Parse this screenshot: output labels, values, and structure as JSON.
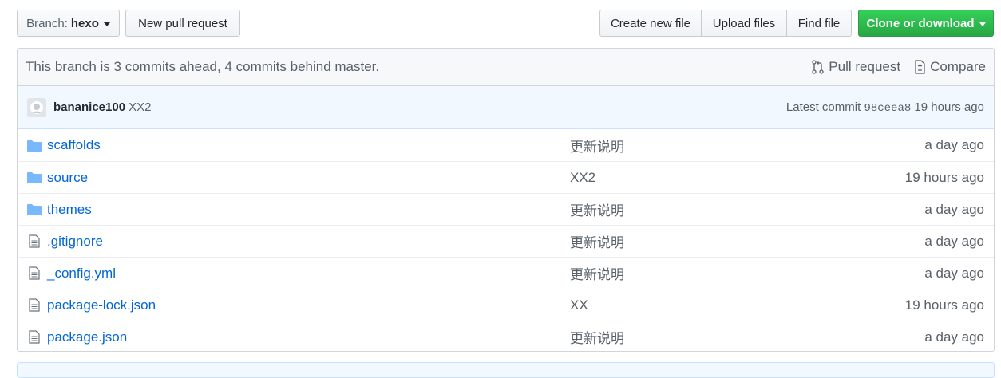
{
  "toolbar": {
    "branch_label": "Branch:",
    "branch_value": "hexo",
    "new_pull_request": "New pull request",
    "create_new_file": "Create new file",
    "upload_files": "Upload files",
    "find_file": "Find file",
    "clone_or_download": "Clone or download"
  },
  "branch_status": {
    "message": "This branch is 3 commits ahead, 4 commits behind master.",
    "pull_request": "Pull request",
    "compare": "Compare"
  },
  "latest_commit": {
    "author": "bananice100",
    "message": "XX2",
    "label": "Latest commit",
    "sha": "98ceea8",
    "age": "19 hours ago"
  },
  "files": [
    {
      "name": "scaffolds",
      "type": "dir",
      "message": "更新说明",
      "age": "a day ago"
    },
    {
      "name": "source",
      "type": "dir",
      "message": "XX2",
      "age": "19 hours ago"
    },
    {
      "name": "themes",
      "type": "dir",
      "message": "更新说明",
      "age": "a day ago"
    },
    {
      "name": ".gitignore",
      "type": "file",
      "message": "更新说明",
      "age": "a day ago"
    },
    {
      "name": "_config.yml",
      "type": "file",
      "message": "更新说明",
      "age": "a day ago"
    },
    {
      "name": "package-lock.json",
      "type": "file",
      "message": "XX",
      "age": "19 hours ago"
    },
    {
      "name": "package.json",
      "type": "file",
      "message": "更新说明",
      "age": "a day ago"
    }
  ],
  "colors": {
    "link": "#0366d6",
    "clone_button": "#28a745",
    "commit_bar": "#f1f8ff",
    "folder_icon": "#79b8ff"
  }
}
